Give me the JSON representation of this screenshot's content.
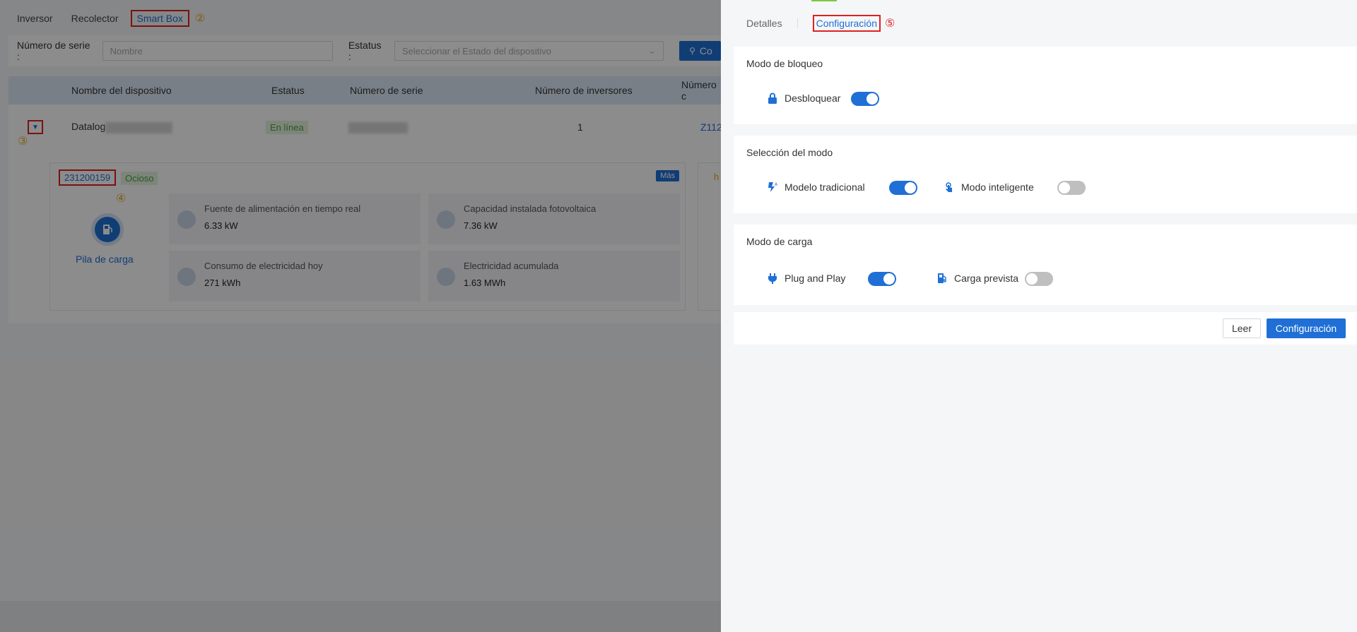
{
  "top_tabs": {
    "inversor": "Inversor",
    "recolector": "Recolector",
    "smart_box": "Smart Box",
    "step2": "②"
  },
  "filters": {
    "serial_label": "Número de serie",
    "serial_placeholder": "Nombre",
    "status_label": "Estatus",
    "status_placeholder": "Seleccionar el Estado del dispositivo",
    "search_label": "Co"
  },
  "table": {
    "headers": [
      "Nombre del dispositivo",
      "Estatus",
      "Número de serie",
      "Número de inversores",
      "Número c"
    ],
    "row": {
      "name": "Datalog",
      "status": "En línea",
      "inverters": "1",
      "extra": "Z112"
    },
    "step3": "③"
  },
  "sub_card": {
    "serial": "231200159",
    "status": "Ocioso",
    "more": "Más",
    "step4": "④",
    "device_label": "Pila de carga",
    "metrics": [
      {
        "label": "Fuente de alimentación en tiempo real",
        "value": "6.33 kW"
      },
      {
        "label": "Capacidad instalada fotovoltaica",
        "value": "7.36 kW"
      },
      {
        "label": "Consumo de electricidad hoy",
        "value": "271 kWh"
      },
      {
        "label": "Electricidad acumulada",
        "value": "1.63 MWh"
      }
    ],
    "side_letter": "h"
  },
  "drawer": {
    "tabs": {
      "details": "Detalles",
      "config": "Configuración",
      "step5": "⑤"
    },
    "lock_section": {
      "title": "Modo de bloqueo",
      "unlock_label": "Desbloquear",
      "unlock_on": true
    },
    "mode_section": {
      "title": "Selección del modo",
      "traditional_label": "Modelo tradicional",
      "traditional_on": true,
      "smart_label": "Modo inteligente",
      "smart_on": false
    },
    "charge_section": {
      "title": "Modo de carga",
      "plug_label": "Plug and Play",
      "plug_on": true,
      "scheduled_label": "Carga prevista",
      "scheduled_on": false
    },
    "buttons": {
      "read": "Leer",
      "configure": "Configuración"
    }
  },
  "colors": {
    "primary": "#1f6fd6",
    "highlight_border": "#e02020",
    "step_yellow": "#e6a817",
    "online_green": "#4aa33a"
  }
}
